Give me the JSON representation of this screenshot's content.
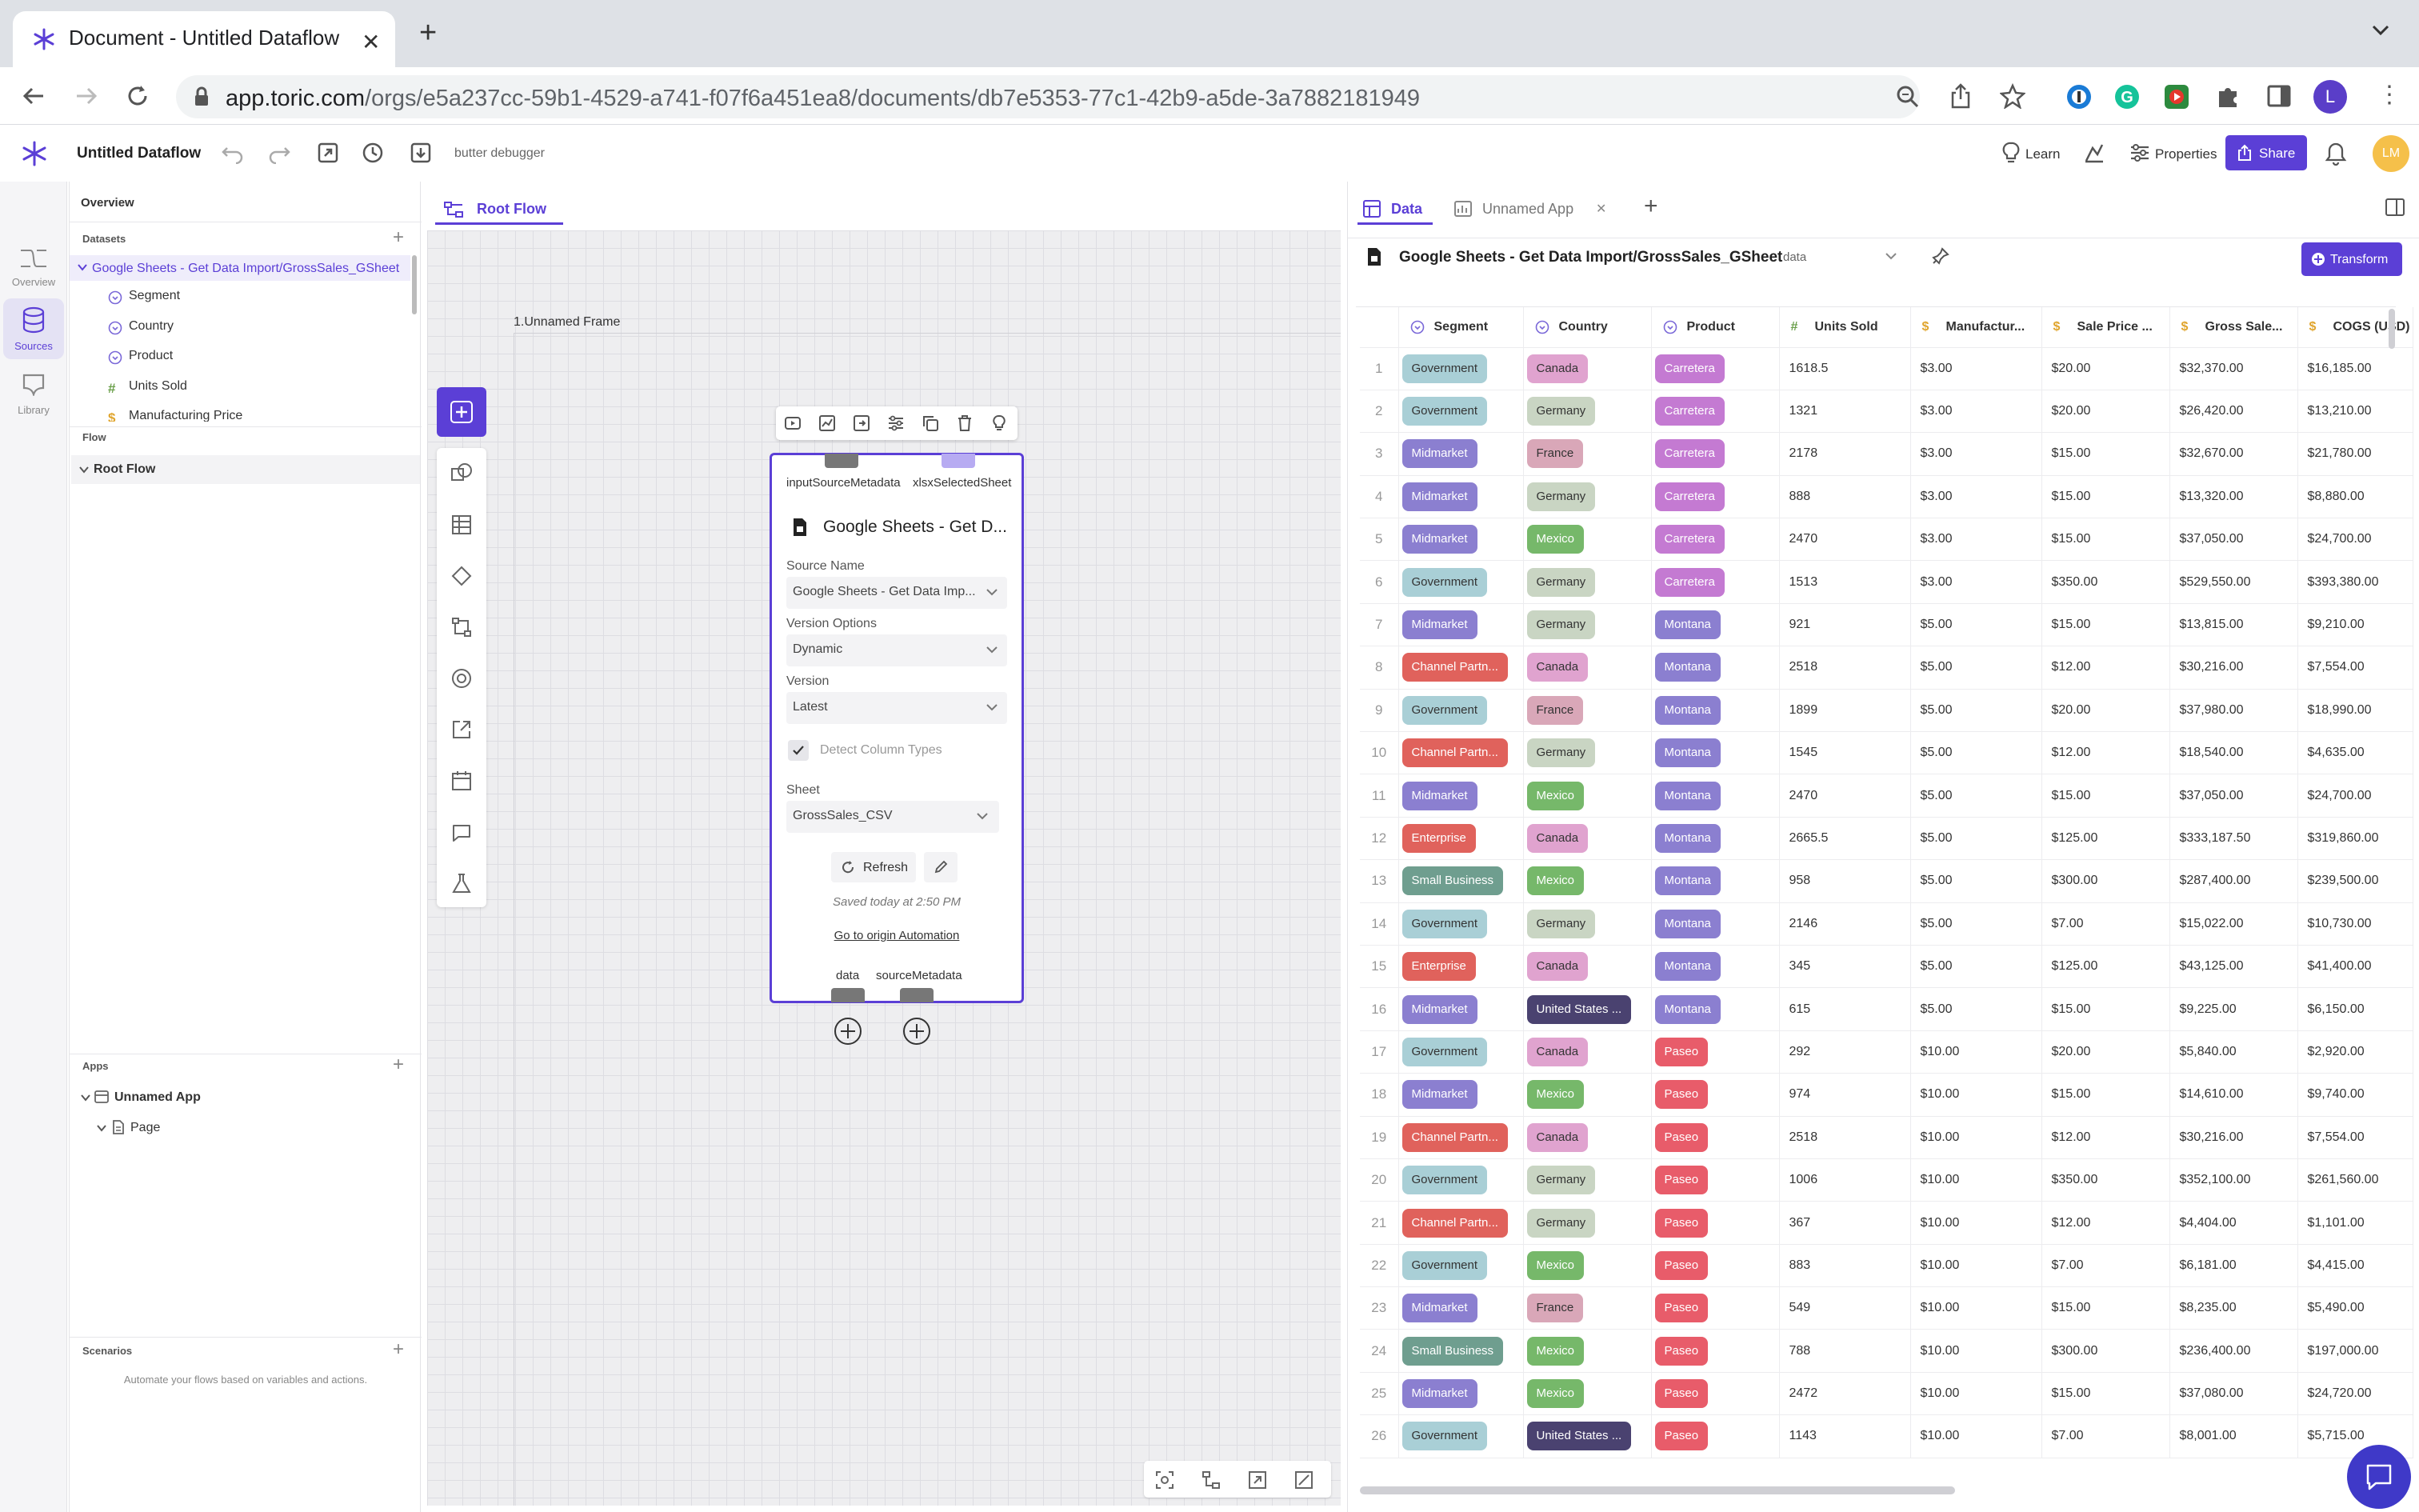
{
  "browser": {
    "tab_title": "Document - Untitled Dataflow",
    "url_domain": "app.toric.com",
    "url_path": "/orgs/e5a237cc-59b1-4529-a741-f07f6a451ea8/documents/db7e5353-77c1-42b9-a5de-3a7882181949",
    "profile_initial": "L"
  },
  "header": {
    "doc_title": "Untitled Dataflow",
    "debugger": "butter debugger",
    "learn": "Learn",
    "properties": "Properties",
    "share": "Share",
    "avatar": "LM"
  },
  "rail": {
    "overview": "Overview",
    "sources": "Sources",
    "library": "Library"
  },
  "left_panel": {
    "overview": "Overview",
    "datasets": "Datasets",
    "dataset_name": "Google Sheets - Get Data Import/GrossSales_GSheet",
    "columns": [
      {
        "name": "Segment",
        "type": "category"
      },
      {
        "name": "Country",
        "type": "category"
      },
      {
        "name": "Product",
        "type": "category"
      },
      {
        "name": "Units Sold",
        "type": "number"
      },
      {
        "name": "Manufacturing Price",
        "type": "currency"
      }
    ],
    "flow": "Flow",
    "root_flow": "Root Flow",
    "apps": "Apps",
    "app_name": "Unnamed App",
    "page_name": "Page",
    "scenarios": "Scenarios",
    "scenarios_desc": "Automate your flows based on variables and actions."
  },
  "center": {
    "tab": "Root Flow",
    "frame_label": "1.Unnamed Frame",
    "node": {
      "input_port_1": "inputSourceMetadata",
      "input_port_2": "xlsxSelectedSheet",
      "title": "Google Sheets - Get D...",
      "source_name_label": "Source Name",
      "source_name_value": "Google Sheets - Get Data Imp...",
      "version_options_label": "Version Options",
      "version_options_value": "Dynamic",
      "version_label": "Version",
      "version_value": "Latest",
      "detect_label": "Detect Column Types",
      "sheet_label": "Sheet",
      "sheet_value": "GrossSales_CSV",
      "refresh": "Refresh",
      "saved": "Saved today at 2:50 PM",
      "origin_link": "Go to origin Automation",
      "output_port_1": "data",
      "output_port_2": "sourceMetadata"
    }
  },
  "right": {
    "tab_data": "Data",
    "tab_app": "Unnamed App",
    "dataset_title": "Google Sheets - Get Data Import/GrossSales_GSheet",
    "dataset_port": "data",
    "transform": "Transform",
    "columns": [
      "Segment",
      "Country",
      "Product",
      "Units Sold",
      "Manufactur...",
      "Sale Price ...",
      "Gross Sale...",
      "COGS (USD)"
    ],
    "rows": [
      [
        "1",
        "Government",
        "Canada",
        "Carretera",
        "1618.5",
        "$3.00",
        "$20.00",
        "$32,370.00",
        "$16,185.00"
      ],
      [
        "2",
        "Government",
        "Germany",
        "Carretera",
        "1321",
        "$3.00",
        "$20.00",
        "$26,420.00",
        "$13,210.00"
      ],
      [
        "3",
        "Midmarket",
        "France",
        "Carretera",
        "2178",
        "$3.00",
        "$15.00",
        "$32,670.00",
        "$21,780.00"
      ],
      [
        "4",
        "Midmarket",
        "Germany",
        "Carretera",
        "888",
        "$3.00",
        "$15.00",
        "$13,320.00",
        "$8,880.00"
      ],
      [
        "5",
        "Midmarket",
        "Mexico",
        "Carretera",
        "2470",
        "$3.00",
        "$15.00",
        "$37,050.00",
        "$24,700.00"
      ],
      [
        "6",
        "Government",
        "Germany",
        "Carretera",
        "1513",
        "$3.00",
        "$350.00",
        "$529,550.00",
        "$393,380.00"
      ],
      [
        "7",
        "Midmarket",
        "Germany",
        "Montana",
        "921",
        "$5.00",
        "$15.00",
        "$13,815.00",
        "$9,210.00"
      ],
      [
        "8",
        "Channel Partn...",
        "Canada",
        "Montana",
        "2518",
        "$5.00",
        "$12.00",
        "$30,216.00",
        "$7,554.00"
      ],
      [
        "9",
        "Government",
        "France",
        "Montana",
        "1899",
        "$5.00",
        "$20.00",
        "$37,980.00",
        "$18,990.00"
      ],
      [
        "10",
        "Channel Partn...",
        "Germany",
        "Montana",
        "1545",
        "$5.00",
        "$12.00",
        "$18,540.00",
        "$4,635.00"
      ],
      [
        "11",
        "Midmarket",
        "Mexico",
        "Montana",
        "2470",
        "$5.00",
        "$15.00",
        "$37,050.00",
        "$24,700.00"
      ],
      [
        "12",
        "Enterprise",
        "Canada",
        "Montana",
        "2665.5",
        "$5.00",
        "$125.00",
        "$333,187.50",
        "$319,860.00"
      ],
      [
        "13",
        "Small Business",
        "Mexico",
        "Montana",
        "958",
        "$5.00",
        "$300.00",
        "$287,400.00",
        "$239,500.00"
      ],
      [
        "14",
        "Government",
        "Germany",
        "Montana",
        "2146",
        "$5.00",
        "$7.00",
        "$15,022.00",
        "$10,730.00"
      ],
      [
        "15",
        "Enterprise",
        "Canada",
        "Montana",
        "345",
        "$5.00",
        "$125.00",
        "$43,125.00",
        "$41,400.00"
      ],
      [
        "16",
        "Midmarket",
        "United States ...",
        "Montana",
        "615",
        "$5.00",
        "$15.00",
        "$9,225.00",
        "$6,150.00"
      ],
      [
        "17",
        "Government",
        "Canada",
        "Paseo",
        "292",
        "$10.00",
        "$20.00",
        "$5,840.00",
        "$2,920.00"
      ],
      [
        "18",
        "Midmarket",
        "Mexico",
        "Paseo",
        "974",
        "$10.00",
        "$15.00",
        "$14,610.00",
        "$9,740.00"
      ],
      [
        "19",
        "Channel Partn...",
        "Canada",
        "Paseo",
        "2518",
        "$10.00",
        "$12.00",
        "$30,216.00",
        "$7,554.00"
      ],
      [
        "20",
        "Government",
        "Germany",
        "Paseo",
        "1006",
        "$10.00",
        "$350.00",
        "$352,100.00",
        "$261,560.00"
      ],
      [
        "21",
        "Channel Partn...",
        "Germany",
        "Paseo",
        "367",
        "$10.00",
        "$12.00",
        "$4,404.00",
        "$1,101.00"
      ],
      [
        "22",
        "Government",
        "Mexico",
        "Paseo",
        "883",
        "$10.00",
        "$7.00",
        "$6,181.00",
        "$4,415.00"
      ],
      [
        "23",
        "Midmarket",
        "France",
        "Paseo",
        "549",
        "$10.00",
        "$15.00",
        "$8,235.00",
        "$5,490.00"
      ],
      [
        "24",
        "Small Business",
        "Mexico",
        "Paseo",
        "788",
        "$10.00",
        "$300.00",
        "$236,400.00",
        "$197,000.00"
      ],
      [
        "25",
        "Midmarket",
        "Mexico",
        "Paseo",
        "2472",
        "$10.00",
        "$15.00",
        "$37,080.00",
        "$24,720.00"
      ],
      [
        "26",
        "Government",
        "United States ...",
        "Paseo",
        "1143",
        "$10.00",
        "$7.00",
        "$8,001.00",
        "$5,715.00"
      ]
    ],
    "segment_colors": {
      "Government": "#a9cfd6",
      "Midmarket": "#8b7fd0",
      "Channel Partn...": "#e0625c",
      "Enterprise": "#e0625c",
      "Small Business": "#6f9e8f"
    },
    "country_colors": {
      "Canada": "#e0a3cf",
      "Germany": "#c9d5c3",
      "France": "#d9a7b8",
      "Mexico": "#76b86a",
      "United States ...": "#4a4270"
    },
    "product_colors": {
      "Carretera": "#c47ad2",
      "Montana": "#8b7fd0",
      "Paseo": "#e85c6a"
    }
  },
  "colors": {
    "accent": "#5b3fd6",
    "canvas": "#eeeef0"
  }
}
